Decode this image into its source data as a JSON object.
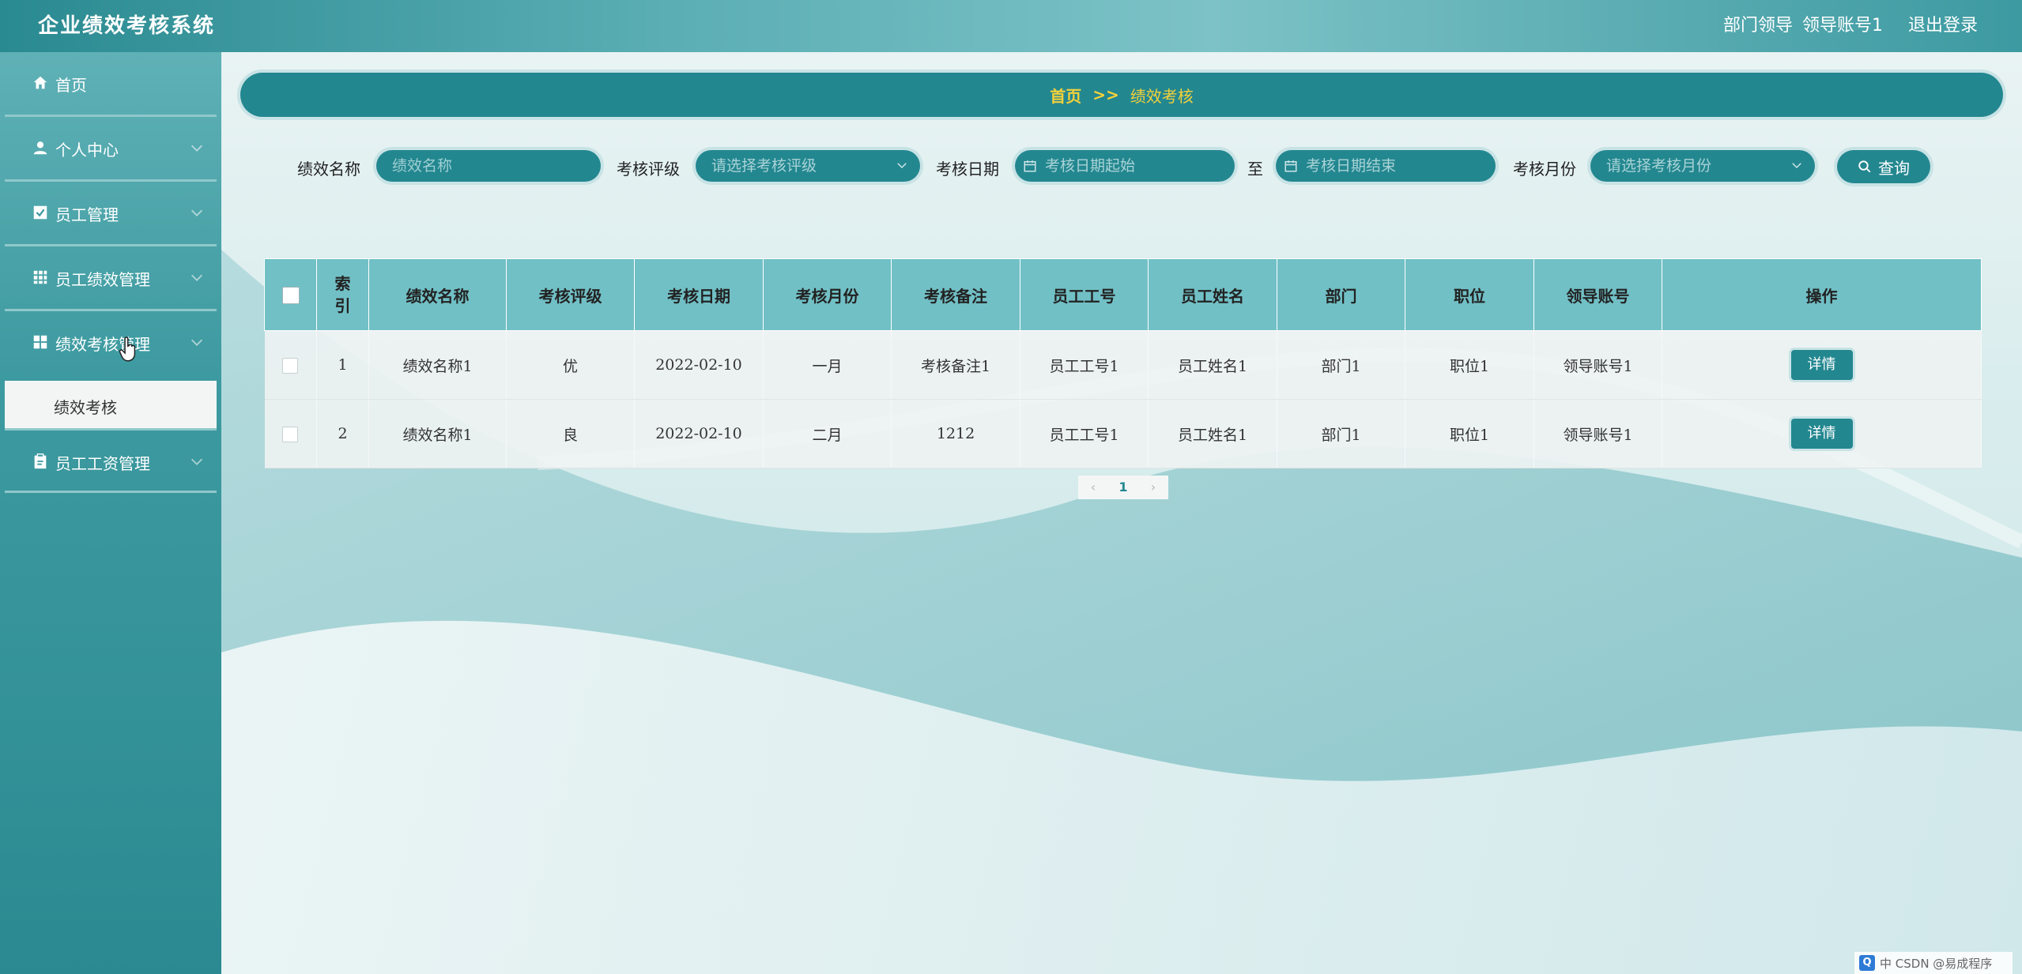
{
  "header": {
    "title": "企业绩效考核系统",
    "role": "部门领导",
    "account": "领导账号1",
    "logout": "退出登录"
  },
  "sidebar": {
    "items": [
      {
        "label": "首页",
        "icon": "home-icon"
      },
      {
        "label": "个人中心",
        "icon": "user-icon"
      },
      {
        "label": "员工管理",
        "icon": "check-square-icon"
      },
      {
        "label": "员工绩效管理",
        "icon": "grid-icon"
      },
      {
        "label": "绩效考核管理",
        "icon": "apps-icon"
      },
      {
        "label": "员工工资管理",
        "icon": "clipboard-icon"
      }
    ],
    "submenu_label": "绩效考核"
  },
  "breadcrumb": {
    "home": "首页",
    "separator": ">>",
    "current": "绩效考核"
  },
  "search": {
    "name_label": "绩效名称",
    "name_placeholder": "绩效名称",
    "grade_label": "考核评级",
    "grade_placeholder": "请选择考核评级",
    "date_label": "考核日期",
    "date_start_placeholder": "考核日期起始",
    "date_to": "至",
    "date_end_placeholder": "考核日期结束",
    "month_label": "考核月份",
    "month_placeholder": "请选择考核月份",
    "search_button": "查询"
  },
  "table": {
    "columns": [
      "索引",
      "绩效名称",
      "考核评级",
      "考核日期",
      "考核月份",
      "考核备注",
      "员工工号",
      "员工姓名",
      "部门",
      "职位",
      "领导账号",
      "操作"
    ],
    "rows": [
      {
        "index": "1",
        "name": "绩效名称1",
        "grade": "优",
        "date": "2022-02-10",
        "month": "一月",
        "remark": "考核备注1",
        "emp_no": "员工工号1",
        "emp_name": "员工姓名1",
        "dept": "部门1",
        "position": "职位1",
        "leader": "领导账号1",
        "action": "详情"
      },
      {
        "index": "2",
        "name": "绩效名称1",
        "grade": "良",
        "date": "2022-02-10",
        "month": "二月",
        "remark": "1212",
        "emp_no": "员工工号1",
        "emp_name": "员工姓名1",
        "dept": "部门1",
        "position": "职位1",
        "leader": "领导账号1",
        "action": "详情"
      }
    ]
  },
  "pagination": {
    "prev": "‹",
    "current_page": "1",
    "next": "›"
  },
  "watermark": {
    "icon_text": "Q",
    "text": "中 CSDN @易成程序"
  },
  "colors": {
    "primary": "#238790",
    "header_th": "#71c0c6",
    "crumb_text": "#f4d13a"
  }
}
